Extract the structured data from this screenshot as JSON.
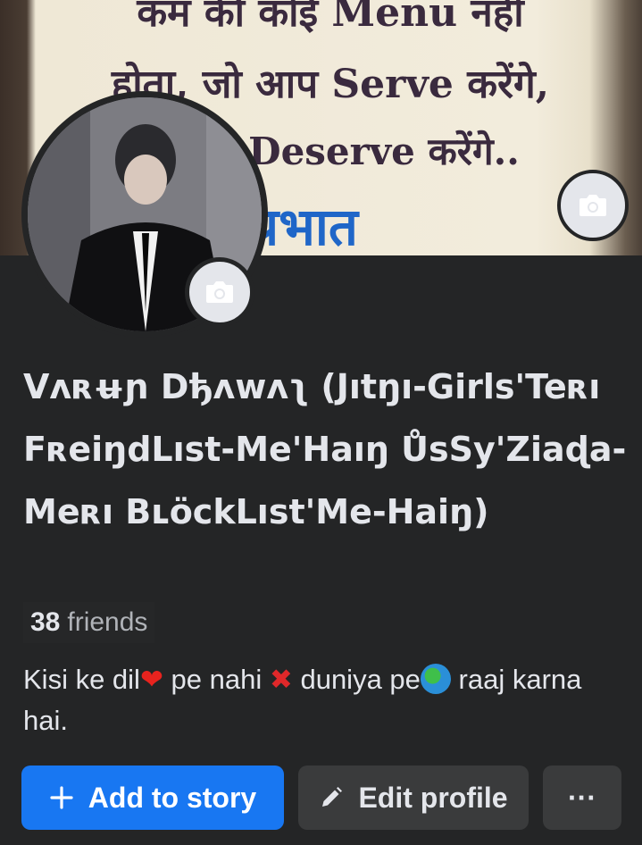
{
  "cover": {
    "lines": [
      "कम की कोई Menu नहीं",
      "होता, जो आप Serve करेंगे,",
      "Deserve करेंगे..",
      "प्रभात"
    ],
    "camera_icon": "camera-icon"
  },
  "profile": {
    "avatar_camera_icon": "camera-icon",
    "name": "Vʌʀʉɲ Dђʌwʌʅ (Jıtŋı-Girls'Teʀı FʀeiŋdLıst-Me'Haıŋ ŮsSy'Ziaɖa-Meʀı BʟöckLıst'Me-Haiŋ)",
    "friends_count": "38",
    "friends_label": "friends",
    "bio": {
      "part1": "Kisi ke dil",
      "heart": "❤",
      "part2": " pe nahi ",
      "cross": "✖",
      "part3": " duniya pe",
      "part4": " raaj karna hai."
    }
  },
  "actions": {
    "add_story": "Add to story",
    "edit_profile": "Edit profile",
    "more": "···"
  },
  "colors": {
    "background": "#242526",
    "primary": "#1877f2",
    "secondary_button": "#3a3b3c",
    "text": "#e4e6eb",
    "muted_text": "#b0b3b8"
  }
}
